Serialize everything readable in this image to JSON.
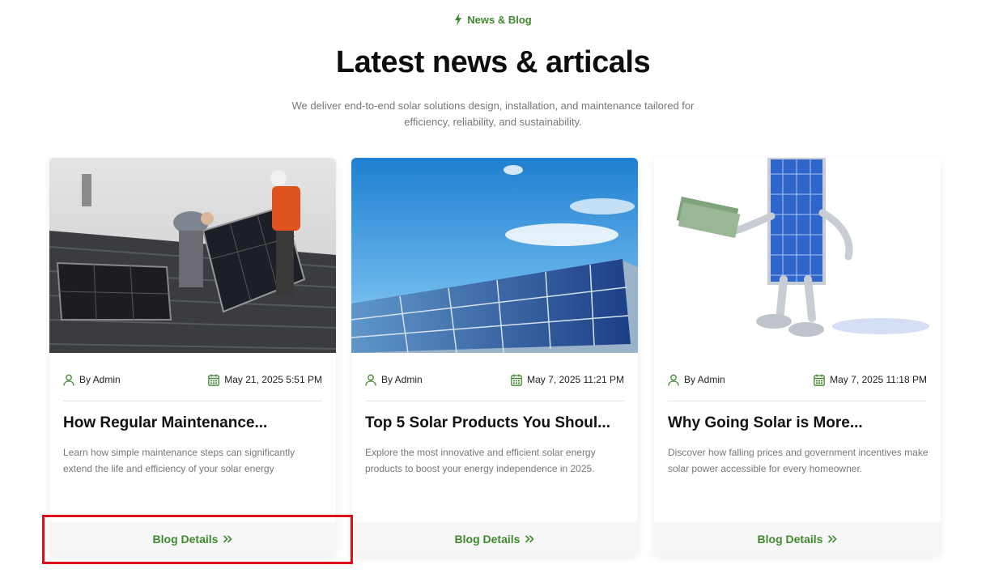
{
  "header": {
    "eyebrow": "News & Blog",
    "title": "Latest news & articals",
    "subtitle": "We deliver end-to-end solar solutions design, installation, and maintenance tailored for efficiency, reliability, and sustainability."
  },
  "colors": {
    "accent": "#3f8a2e",
    "highlight": "#e0101a"
  },
  "posts": [
    {
      "author": "By Admin",
      "date": "May 21, 2025 5:51 PM",
      "title": "How Regular Maintenance...",
      "excerpt": "Learn how simple maintenance steps can significantly extend the life and efficiency of your solar energy",
      "button": "Blog Details"
    },
    {
      "author": "By Admin",
      "date": "May 7, 2025 11:21 PM",
      "title": "Top 5 Solar Products You Shoul...",
      "excerpt": "Explore the most innovative and efficient solar energy products to boost your energy independence in 2025.",
      "button": "Blog Details"
    },
    {
      "author": "By Admin",
      "date": "May 7, 2025 11:18 PM",
      "title": "Why Going Solar is More...",
      "excerpt": "Discover how falling prices and government incentives make solar power accessible for every homeowner.",
      "button": "Blog Details"
    }
  ]
}
